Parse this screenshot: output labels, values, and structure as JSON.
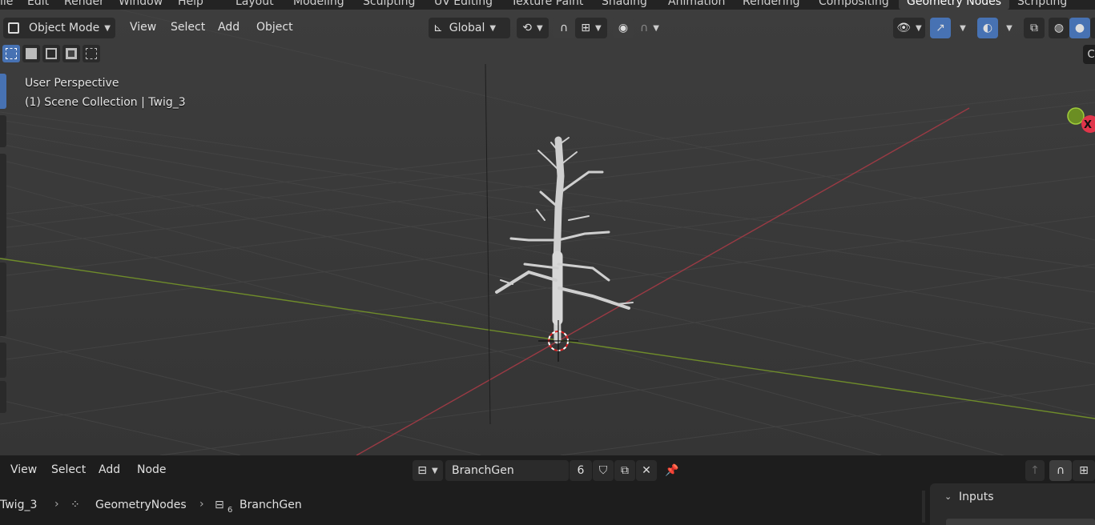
{
  "top_menu": [
    "ile",
    "Edit",
    "Render",
    "Window",
    "Help"
  ],
  "workspace_tabs": [
    {
      "label": "Layout",
      "active": false
    },
    {
      "label": "Modeling",
      "active": false
    },
    {
      "label": "Sculpting",
      "active": false
    },
    {
      "label": "UV Editing",
      "active": false
    },
    {
      "label": "Texture Paint",
      "active": false
    },
    {
      "label": "Shading",
      "active": false
    },
    {
      "label": "Animation",
      "active": false
    },
    {
      "label": "Rendering",
      "active": false
    },
    {
      "label": "Compositing",
      "active": false
    },
    {
      "label": "Geometry Nodes",
      "active": true
    },
    {
      "label": "Scripting",
      "active": false
    }
  ],
  "viewport_header": {
    "mode": "Object Mode",
    "menus": [
      "View",
      "Select",
      "Add",
      "Object"
    ],
    "transform_orientation": "Global"
  },
  "viewport_overlay": {
    "perspective": "User Perspective",
    "collection": "(1) Scene Collection | Twig_3"
  },
  "gizmo": {
    "x_label": "X",
    "right_edge_letter": "C"
  },
  "node_editor": {
    "menus": [
      "View",
      "Select",
      "Add",
      "Node"
    ],
    "node_group_name": "BranchGen",
    "user_count": "6",
    "breadcrumb": [
      "Twig_3",
      "GeometryNodes",
      "BranchGen"
    ],
    "breadcrumb_sub": "6",
    "panel_title": "Inputs"
  },
  "colors": {
    "accent": "#4772b3",
    "x_axis": "#b0414c",
    "y_axis": "#7a9c2e",
    "header_bg": "#1d1d1d",
    "viewport_bg": "#3a3a3a"
  }
}
